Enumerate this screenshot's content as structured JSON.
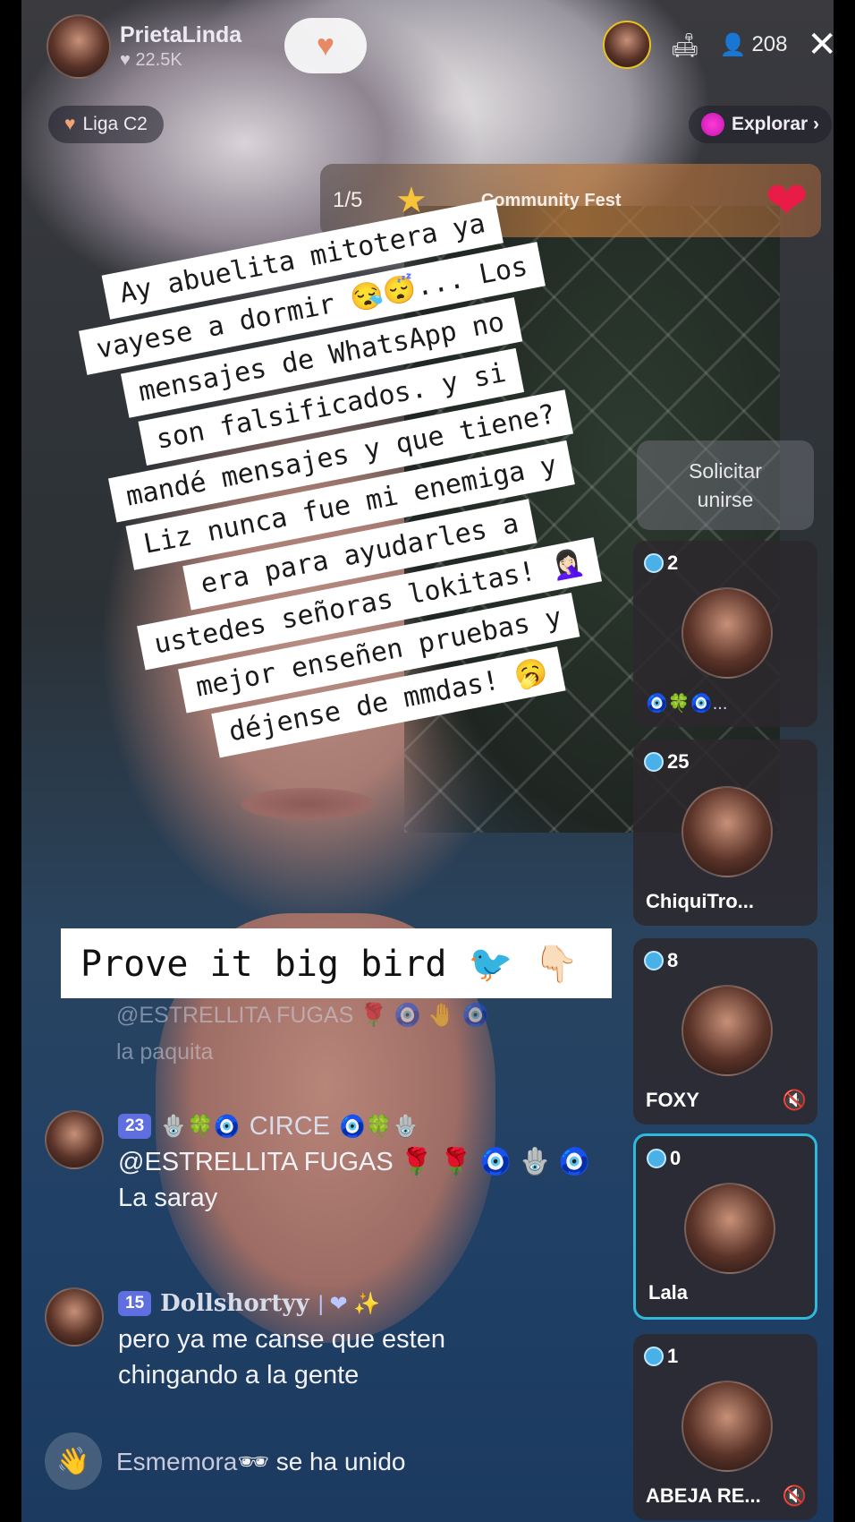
{
  "host": {
    "name": "PrietaLinda",
    "likes": "22.5K",
    "follow_icon": "heart-follow-icon"
  },
  "top_right": {
    "viewers": "208",
    "close": "✕"
  },
  "league": {
    "label": "Liga C2"
  },
  "explore": {
    "label": "Explorar ›"
  },
  "fest": {
    "count": "1/5",
    "title": "Community Fest"
  },
  "sticker_lines": [
    "Ay abuelita mitotera ya",
    "vayese a dormir 😪😴... Los",
    "mensajes de WhatsApp no",
    "son falsificados. y si",
    "mandé mensajes y que tiene?",
    "Liz nunca fue mi enemiga y",
    "era para ayudarles a",
    "ustedes señoras lokitas! 🤦🏻‍♀️",
    "mejor enseñen pruebas y",
    "déjense de mmdas! 🥱"
  ],
  "prove_banner": "Prove it big bird 🐦 👇🏻",
  "request_join": {
    "line1": "Solicitar",
    "line2": "unirse"
  },
  "guests": [
    {
      "count": "2",
      "name": "",
      "icons": "🧿🍀🧿..."
    },
    {
      "count": "25",
      "name": "ChiquiTro..."
    },
    {
      "count": "8",
      "name": "FOXY"
    },
    {
      "count": "0",
      "name": "Lala"
    },
    {
      "count": "1",
      "name": "ABEJA RE..."
    }
  ],
  "comments": {
    "faded": {
      "line1": "@ESTRELLITA FUGAS 🌹 🧿 🤚 🧿",
      "line2": "la paquita"
    },
    "items": [
      {
        "level": "23",
        "user": "CIRCE",
        "emojis_before": "🪬🍀🧿",
        "emojis_after": "🧿🍀🪬",
        "text1": "@ESTRELLITA FUGAS 🌹 🌹 🧿 🪬 🧿",
        "text2": "La saray"
      },
      {
        "level": "15",
        "user": "Dollshortyy",
        "emojis_after": "| ❤ ✨",
        "text1": "pero ya me canse que esten",
        "text2": "chingando a la gente"
      }
    ],
    "join": {
      "user": "Esmemora",
      "suffix": "se ha unido"
    }
  },
  "colors": {
    "accent_blue": "#30b8d8",
    "level_badge": "#5f6fe0",
    "explore_dot": "#ff3ad7"
  }
}
